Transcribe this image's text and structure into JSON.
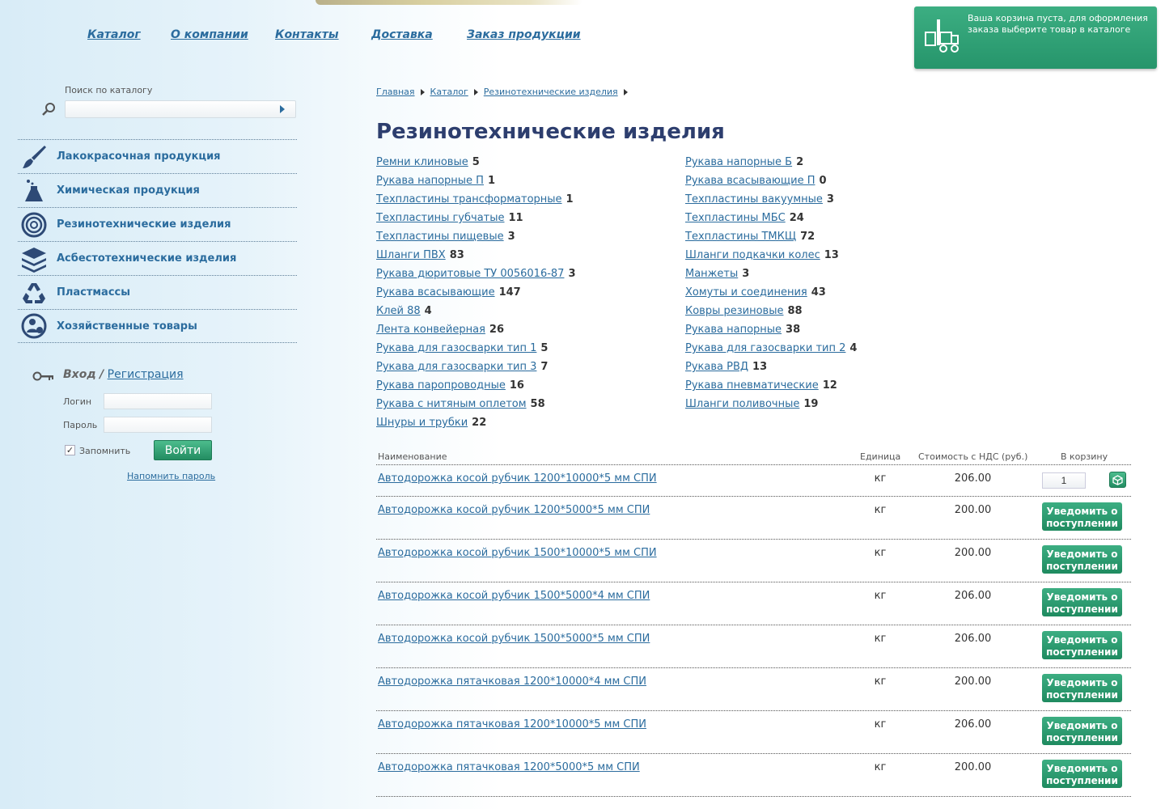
{
  "nav": {
    "items": [
      "Каталог",
      "О компании",
      "Контакты",
      "Доставка",
      "Заказ продукции"
    ]
  },
  "cart": {
    "text": "Ваша корзина пуста, для оформления заказа выберите товар в каталоге",
    "icon": "cart-truck-icon"
  },
  "search": {
    "label": "Поиск по каталогу",
    "value": ""
  },
  "left_menu": [
    {
      "label": "Лакокрасочная продукция",
      "icon": "paint-brush-icon"
    },
    {
      "label": "Химическая продукция",
      "icon": "flask-icon"
    },
    {
      "label": "Резинотехнические изделия",
      "icon": "rubber-coil-icon"
    },
    {
      "label": "Асбестотехнические изделия",
      "icon": "layers-icon"
    },
    {
      "label": "Пластмассы",
      "icon": "recycle-icon"
    },
    {
      "label": "Хозяйственные товары",
      "icon": "household-icon"
    }
  ],
  "login": {
    "title": "Вход",
    "separator": "/",
    "register": "Регистрация",
    "login_label": "Логин",
    "password_label": "Пароль",
    "remember_label": "Запомнить",
    "remember_checked": true,
    "submit": "Войти",
    "forgot": "Напомнить пароль"
  },
  "breadcrumb": [
    "Главная",
    "Каталог",
    "Резинотехнические изделия"
  ],
  "page": {
    "title": "Резинотехнические изделия"
  },
  "categories_left": [
    {
      "name": "Ремни клиновые",
      "count": "5"
    },
    {
      "name": "Рукава напорные П",
      "count": "1"
    },
    {
      "name": "Техпластины трансформаторные",
      "count": "1"
    },
    {
      "name": "Техпластины губчатые",
      "count": "11"
    },
    {
      "name": "Техпластины пищевые",
      "count": "3"
    },
    {
      "name": "Шланги ПВХ",
      "count": "83"
    },
    {
      "name": "Рукава дюритовые ТУ 0056016-87",
      "count": "3"
    },
    {
      "name": "Рукава всасывающие",
      "count": "147"
    },
    {
      "name": "Клей 88",
      "count": "4"
    },
    {
      "name": "Лента конвейерная",
      "count": "26"
    },
    {
      "name": "Рукава для газосварки тип 1",
      "count": "5"
    },
    {
      "name": "Рукава для газосварки тип 3",
      "count": "7"
    },
    {
      "name": "Рукава паропроводные",
      "count": "16"
    },
    {
      "name": "Рукава с нитяным оплетом",
      "count": "58"
    },
    {
      "name": "Шнуры и трубки",
      "count": "22"
    }
  ],
  "categories_right": [
    {
      "name": "Рукава напорные Б",
      "count": "2"
    },
    {
      "name": "Рукава всасывающие П",
      "count": "0"
    },
    {
      "name": "Техпластины вакуумные",
      "count": "3"
    },
    {
      "name": "Техпластины МБС",
      "count": "24"
    },
    {
      "name": "Техпластины ТМКЩ",
      "count": "72"
    },
    {
      "name": "Шланги подкачки колес",
      "count": "13"
    },
    {
      "name": "Манжеты",
      "count": "3"
    },
    {
      "name": "Хомуты и соединения",
      "count": "43"
    },
    {
      "name": "Ковры резиновые",
      "count": "88"
    },
    {
      "name": "Рукава напорные",
      "count": "38"
    },
    {
      "name": "Рукава для газосварки тип 2",
      "count": "4"
    },
    {
      "name": "Рукава РВД",
      "count": "13"
    },
    {
      "name": "Рукава пневматические",
      "count": "12"
    },
    {
      "name": "Шланги поливочные",
      "count": "19"
    }
  ],
  "products": {
    "headers": {
      "name": "Наименование",
      "unit": "Единица",
      "price": "Стоимость с НДС (руб.)",
      "cart": "В корзину"
    },
    "notify_label": "Уведомить о поступлении",
    "rows": [
      {
        "name": "Автодорожка косой рубчик 1200*10000*5 мм СПИ",
        "unit": "кг",
        "price": "206.00",
        "in_stock": true,
        "qty": "1"
      },
      {
        "name": "Автодорожка косой рубчик 1200*5000*5 мм СПИ",
        "unit": "кг",
        "price": "200.00",
        "in_stock": false
      },
      {
        "name": "Автодорожка косой рубчик 1500*10000*5 мм СПИ",
        "unit": "кг",
        "price": "200.00",
        "in_stock": false
      },
      {
        "name": "Автодорожка косой рубчик 1500*5000*4 мм СПИ",
        "unit": "кг",
        "price": "206.00",
        "in_stock": false
      },
      {
        "name": "Автодорожка косой рубчик 1500*5000*5 мм СПИ",
        "unit": "кг",
        "price": "206.00",
        "in_stock": false
      },
      {
        "name": "Автодорожка пятачковая 1200*10000*4 мм СПИ",
        "unit": "кг",
        "price": "200.00",
        "in_stock": false
      },
      {
        "name": "Автодорожка пятачковая 1200*10000*5 мм СПИ",
        "unit": "кг",
        "price": "206.00",
        "in_stock": false
      },
      {
        "name": "Автодорожка пятачковая 1200*5000*5 мм СПИ",
        "unit": "кг",
        "price": "200.00",
        "in_stock": false
      }
    ]
  },
  "colors": {
    "link": "#2b6c9e",
    "accent_green": "#26956b",
    "title": "#2d3e6e"
  }
}
